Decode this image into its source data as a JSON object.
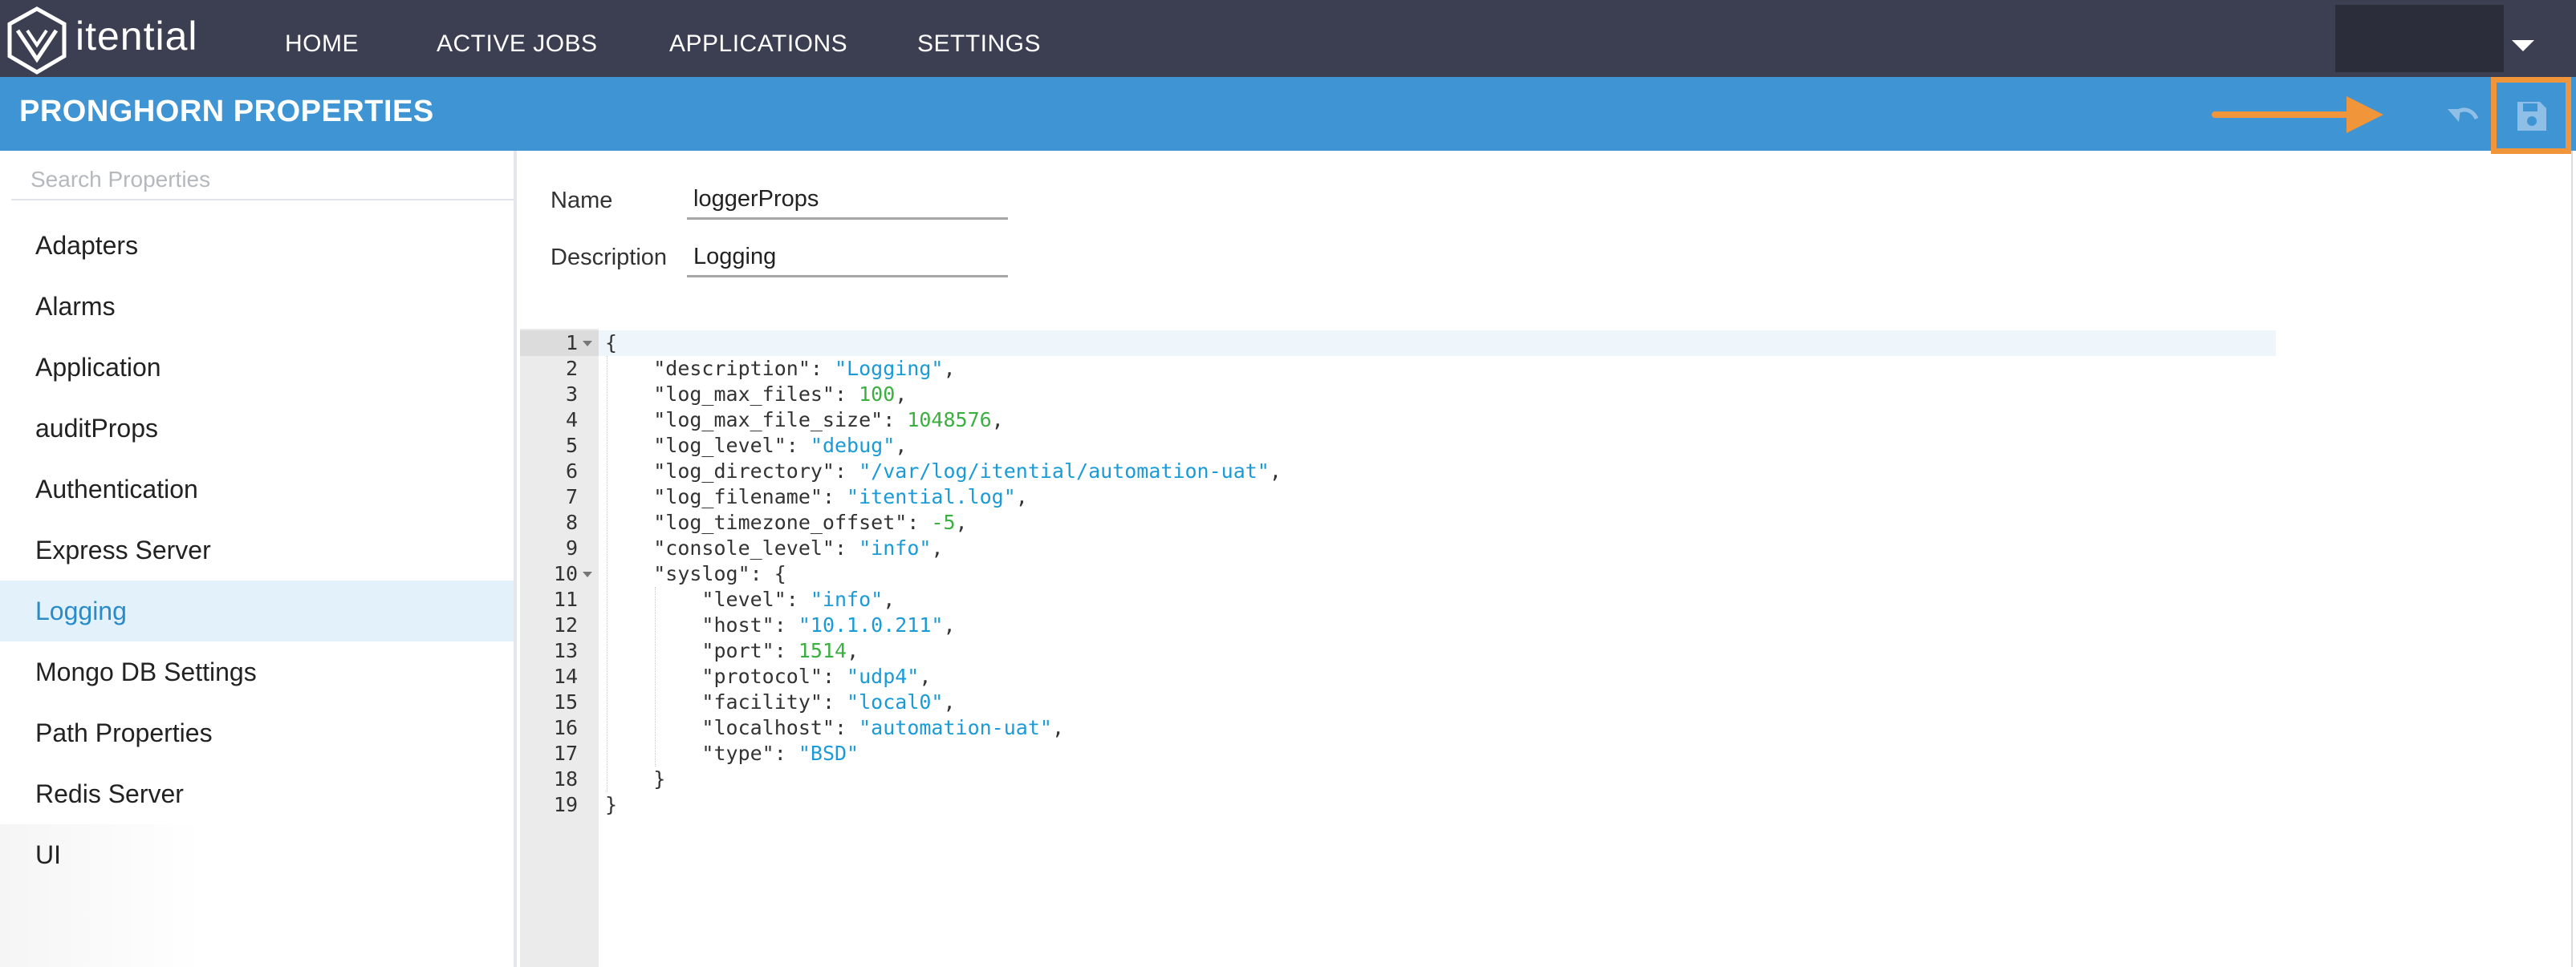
{
  "app": {
    "logo_text": "itential",
    "nav": [
      "HOME",
      "ACTIVE JOBS",
      "APPLICATIONS",
      "SETTINGS"
    ]
  },
  "titlebar": {
    "title": "PRONGHORN PROPERTIES",
    "icons": [
      "undo-icon",
      "save-icon",
      "arrow-annotation"
    ]
  },
  "sidebar": {
    "search_placeholder": "Search Properties",
    "items": [
      {
        "label": "Adapters"
      },
      {
        "label": "Alarms"
      },
      {
        "label": "Application"
      },
      {
        "label": "auditProps"
      },
      {
        "label": "Authentication"
      },
      {
        "label": "Express Server"
      },
      {
        "label": "Logging",
        "active": true
      },
      {
        "label": "Mongo DB Settings"
      },
      {
        "label": "Path Properties"
      },
      {
        "label": "Redis Server"
      },
      {
        "label": "UI"
      }
    ]
  },
  "form": {
    "name_label": "Name",
    "name_value": "loggerProps",
    "description_label": "Description",
    "description_value": "Logging"
  },
  "editor": {
    "lines": [
      {
        "n": "1",
        "fold": true,
        "indent": 0,
        "tokens": [
          [
            "p",
            "{"
          ]
        ]
      },
      {
        "n": "2",
        "indent": 1,
        "tokens": [
          [
            "k",
            "\"description\""
          ],
          [
            "p",
            ": "
          ],
          [
            "s",
            "\"Logging\""
          ],
          [
            "p",
            ","
          ]
        ]
      },
      {
        "n": "3",
        "indent": 1,
        "tokens": [
          [
            "k",
            "\"log_max_files\""
          ],
          [
            "p",
            ": "
          ],
          [
            "n",
            "100"
          ],
          [
            "p",
            ","
          ]
        ]
      },
      {
        "n": "4",
        "indent": 1,
        "tokens": [
          [
            "k",
            "\"log_max_file_size\""
          ],
          [
            "p",
            ": "
          ],
          [
            "n",
            "1048576"
          ],
          [
            "p",
            ","
          ]
        ]
      },
      {
        "n": "5",
        "indent": 1,
        "tokens": [
          [
            "k",
            "\"log_level\""
          ],
          [
            "p",
            ": "
          ],
          [
            "s",
            "\"debug\""
          ],
          [
            "p",
            ","
          ]
        ]
      },
      {
        "n": "6",
        "indent": 1,
        "tokens": [
          [
            "k",
            "\"log_directory\""
          ],
          [
            "p",
            ": "
          ],
          [
            "s",
            "\"/var/log/itential/automation-uat\""
          ],
          [
            "p",
            ","
          ]
        ]
      },
      {
        "n": "7",
        "indent": 1,
        "tokens": [
          [
            "k",
            "\"log_filename\""
          ],
          [
            "p",
            ": "
          ],
          [
            "s",
            "\"itential.log\""
          ],
          [
            "p",
            ","
          ]
        ]
      },
      {
        "n": "8",
        "indent": 1,
        "tokens": [
          [
            "k",
            "\"log_timezone_offset\""
          ],
          [
            "p",
            ": "
          ],
          [
            "n",
            "-5"
          ],
          [
            "p",
            ","
          ]
        ]
      },
      {
        "n": "9",
        "indent": 1,
        "tokens": [
          [
            "k",
            "\"console_level\""
          ],
          [
            "p",
            ": "
          ],
          [
            "s",
            "\"info\""
          ],
          [
            "p",
            ","
          ]
        ]
      },
      {
        "n": "10",
        "fold": true,
        "indent": 1,
        "tokens": [
          [
            "k",
            "\"syslog\""
          ],
          [
            "p",
            ": {"
          ]
        ]
      },
      {
        "n": "11",
        "indent": 2,
        "tokens": [
          [
            "k",
            "\"level\""
          ],
          [
            "p",
            ": "
          ],
          [
            "s",
            "\"info\""
          ],
          [
            "p",
            ","
          ]
        ]
      },
      {
        "n": "12",
        "indent": 2,
        "tokens": [
          [
            "k",
            "\"host\""
          ],
          [
            "p",
            ": "
          ],
          [
            "s",
            "\"10.1.0.211\""
          ],
          [
            "p",
            ","
          ]
        ]
      },
      {
        "n": "13",
        "indent": 2,
        "tokens": [
          [
            "k",
            "\"port\""
          ],
          [
            "p",
            ": "
          ],
          [
            "n",
            "1514"
          ],
          [
            "p",
            ","
          ]
        ]
      },
      {
        "n": "14",
        "indent": 2,
        "tokens": [
          [
            "k",
            "\"protocol\""
          ],
          [
            "p",
            ": "
          ],
          [
            "s",
            "\"udp4\""
          ],
          [
            "p",
            ","
          ]
        ]
      },
      {
        "n": "15",
        "indent": 2,
        "tokens": [
          [
            "k",
            "\"facility\""
          ],
          [
            "p",
            ": "
          ],
          [
            "s",
            "\"local0\""
          ],
          [
            "p",
            ","
          ]
        ]
      },
      {
        "n": "16",
        "indent": 2,
        "tokens": [
          [
            "k",
            "\"localhost\""
          ],
          [
            "p",
            ": "
          ],
          [
            "s",
            "\"automation-uat\""
          ],
          [
            "p",
            ","
          ]
        ]
      },
      {
        "n": "17",
        "indent": 2,
        "tokens": [
          [
            "k",
            "\"type\""
          ],
          [
            "p",
            ": "
          ],
          [
            "s",
            "\"BSD\""
          ]
        ]
      },
      {
        "n": "18",
        "indent": 1,
        "tokens": [
          [
            "p",
            "}"
          ]
        ]
      },
      {
        "n": "19",
        "indent": 0,
        "tokens": [
          [
            "p",
            "}"
          ]
        ]
      }
    ]
  },
  "colors": {
    "nav_bg": "#3c3f51",
    "title_bg": "#3f94d4",
    "annotation": "#f0953a",
    "string": "#1a9bd7",
    "number": "#3bb041",
    "active_item_bg": "#e2f1fa",
    "active_item_text": "#2a8bc9"
  }
}
